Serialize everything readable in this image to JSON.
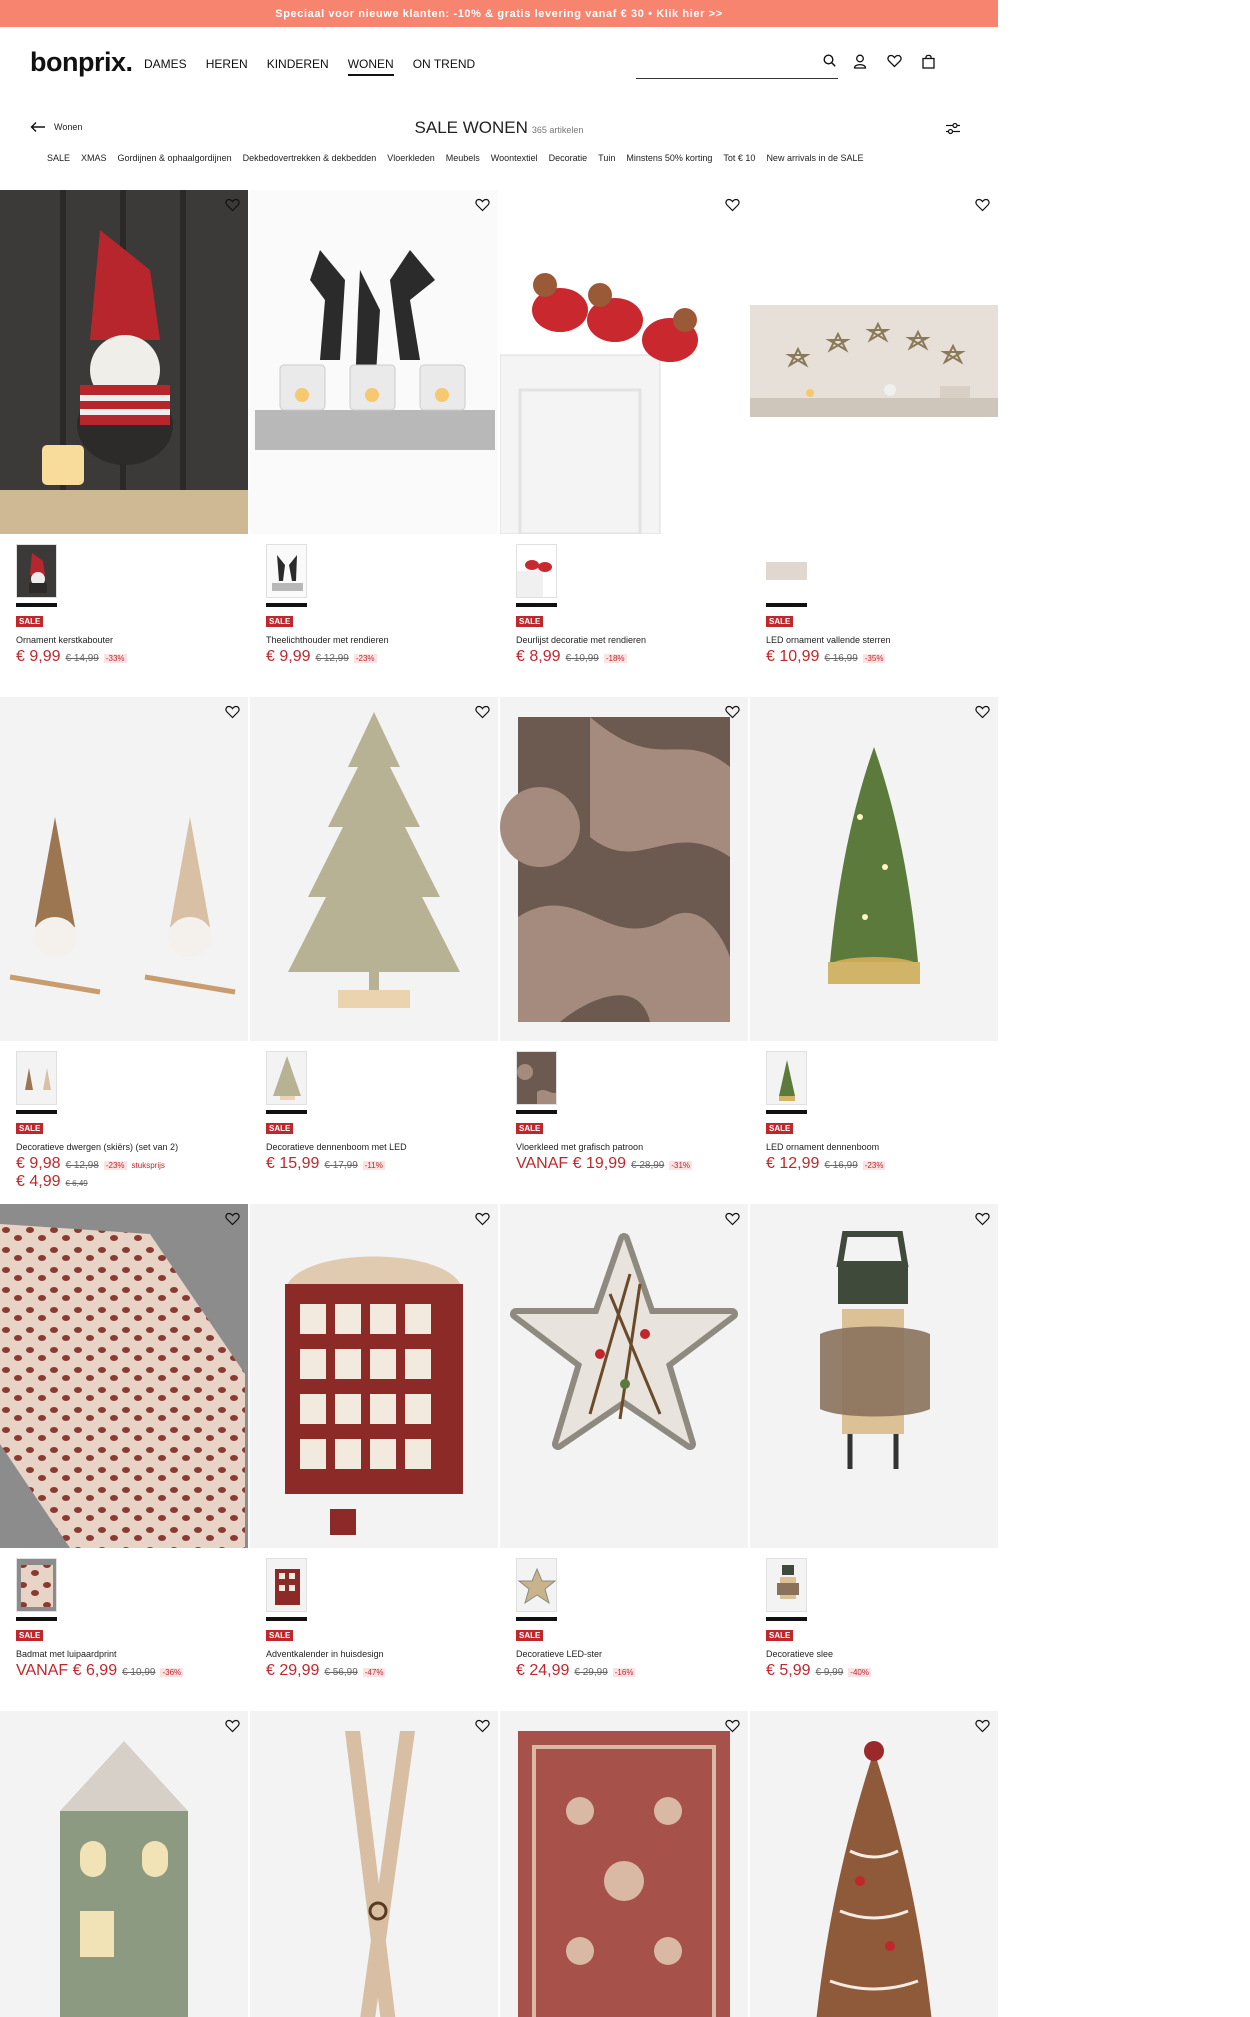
{
  "promo": "Speciaal voor nieuwe klanten: -10% & gratis levering vanaf € 30 • Klik hier >>",
  "header": {
    "logo": "bonprix.",
    "nav": [
      "DAMES",
      "HEREN",
      "KINDEREN",
      "WONEN",
      "ON TREND"
    ],
    "active_nav": "WONEN",
    "search_placeholder": "",
    "icons": [
      "search-icon",
      "account-icon",
      "wishlist-icon",
      "cart-icon"
    ]
  },
  "title_row": {
    "back_label": "Wonen",
    "title": "SALE WONEN",
    "count": "365 artikelen"
  },
  "categories": [
    "SALE",
    "XMAS",
    "Gordijnen & ophaalgordijnen",
    "Dekbedovertrekken & dekbedden",
    "Vloerkleden",
    "Meubels",
    "Woontextiel",
    "Decoratie",
    "Tuin",
    "Minstens 50% korting",
    "Tot € 10",
    "New arrivals in de SALE"
  ],
  "colors": {
    "promo": "#f7846f",
    "sale": "#c0272d",
    "text": "#222222"
  },
  "sale_badge": "SALE",
  "products": [
    {
      "name": "Ornament kerstkabouter",
      "price": "€ 9,99",
      "old": "€ 14,99",
      "disc": "-33%"
    },
    {
      "name": "Theelichthouder met rendieren",
      "price": "€ 9,99",
      "old": "€ 12,99",
      "disc": "-23%"
    },
    {
      "name": "Deurlijst decoratie met rendieren",
      "price": "€ 8,99",
      "old": "€ 10,99",
      "disc": "-18%"
    },
    {
      "name": "LED ornament vallende sterren",
      "price": "€ 10,99",
      "old": "€ 16,99",
      "disc": "-35%"
    },
    {
      "name": "Decoratieve dwergen (skiërs) (set van 2)",
      "price": "€ 9,98",
      "old": "€ 12,98",
      "disc": "-23%",
      "note": "stuksprijs",
      "price2": "€ 4,99",
      "old2": "€ 6,49"
    },
    {
      "name": "Decoratieve dennenboom met LED",
      "price": "€ 15,99",
      "old": "€ 17,99",
      "disc": "-11%"
    },
    {
      "name": "Vloerkleed met grafisch patroon",
      "price": "VANAF € 19,99",
      "old": "€ 28,99",
      "disc": "-31%"
    },
    {
      "name": "LED ornament dennenboom",
      "price": "€ 12,99",
      "old": "€ 16,99",
      "disc": "-23%"
    },
    {
      "name": "Badmat met luipaardprint",
      "price": "VANAF € 6,99",
      "old": "€ 10,99",
      "disc": "-36%"
    },
    {
      "name": "Adventkalender in huisdesign",
      "price": "€ 29,99",
      "old": "€ 56,99",
      "disc": "-47%"
    },
    {
      "name": "Decoratieve LED-ster",
      "price": "€ 24,99",
      "old": "€ 29,99",
      "disc": "-16%"
    },
    {
      "name": "Decoratieve slee",
      "price": "€ 5,99",
      "old": "€ 9,99",
      "disc": "-40%"
    }
  ]
}
